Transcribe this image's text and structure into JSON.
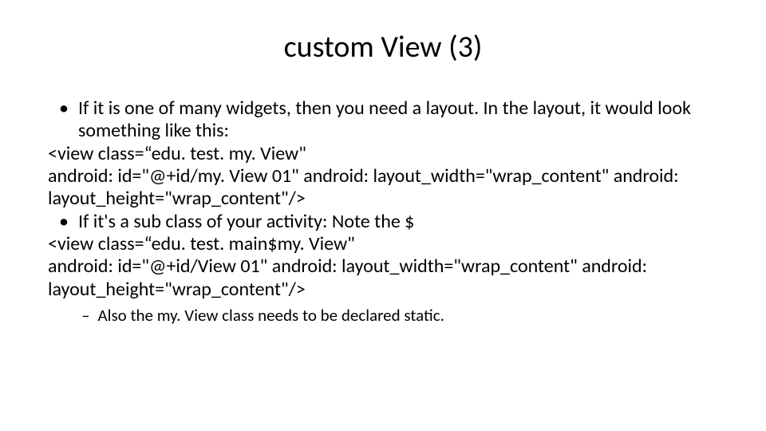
{
  "title": "custom View (3)",
  "body": {
    "bullet1": "If it is one of many widgets, then you need a layout.  In the layout, it would look something like this:",
    "code1_line1": "<view class=“edu. test. my. View\"",
    "code1_line2": "android: id=\"@+id/my. View 01\" android: layout_width=\"wrap_content\" android: layout_height=\"wrap_content\"/>",
    "bullet2": "If it's a sub class of your activity:  Note the $",
    "code2_line1": "<view class=“edu. test. main$my. View\"",
    "code2_line2": "android: id=\"@+id/View 01\" android: layout_width=\"wrap_content\" android: layout_height=\"wrap_content\"/>",
    "sub_bullet": "Also the my. View class needs to be declared static."
  }
}
